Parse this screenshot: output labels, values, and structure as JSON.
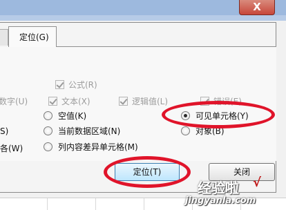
{
  "dialog": {
    "close_glyph": "X",
    "tab_label": "定位(G)"
  },
  "formula_options": {
    "formula": "公式(R)",
    "number_cut": "数字(U)",
    "text": "文本(X)",
    "logical": "逻辑值(L)",
    "error": "错误(E)"
  },
  "left_cut": {
    "s_cut": "S)",
    "w_cut": "各(W)"
  },
  "radios": {
    "blanks": "空值(K)",
    "current_region": "当前数据区域(N)",
    "row_differences": "列内容差异单元格(M)",
    "visible_cells": "可见单元格(Y)",
    "objects": "对象(B)"
  },
  "buttons": {
    "ok": "定位(T)",
    "close": "关闭"
  },
  "watermark": {
    "title": "经验啦",
    "check": "√",
    "url": "jingyanla.com"
  },
  "colors": {
    "annotation_red": "#e0142a",
    "titlebar_blue": "#9db9de"
  }
}
